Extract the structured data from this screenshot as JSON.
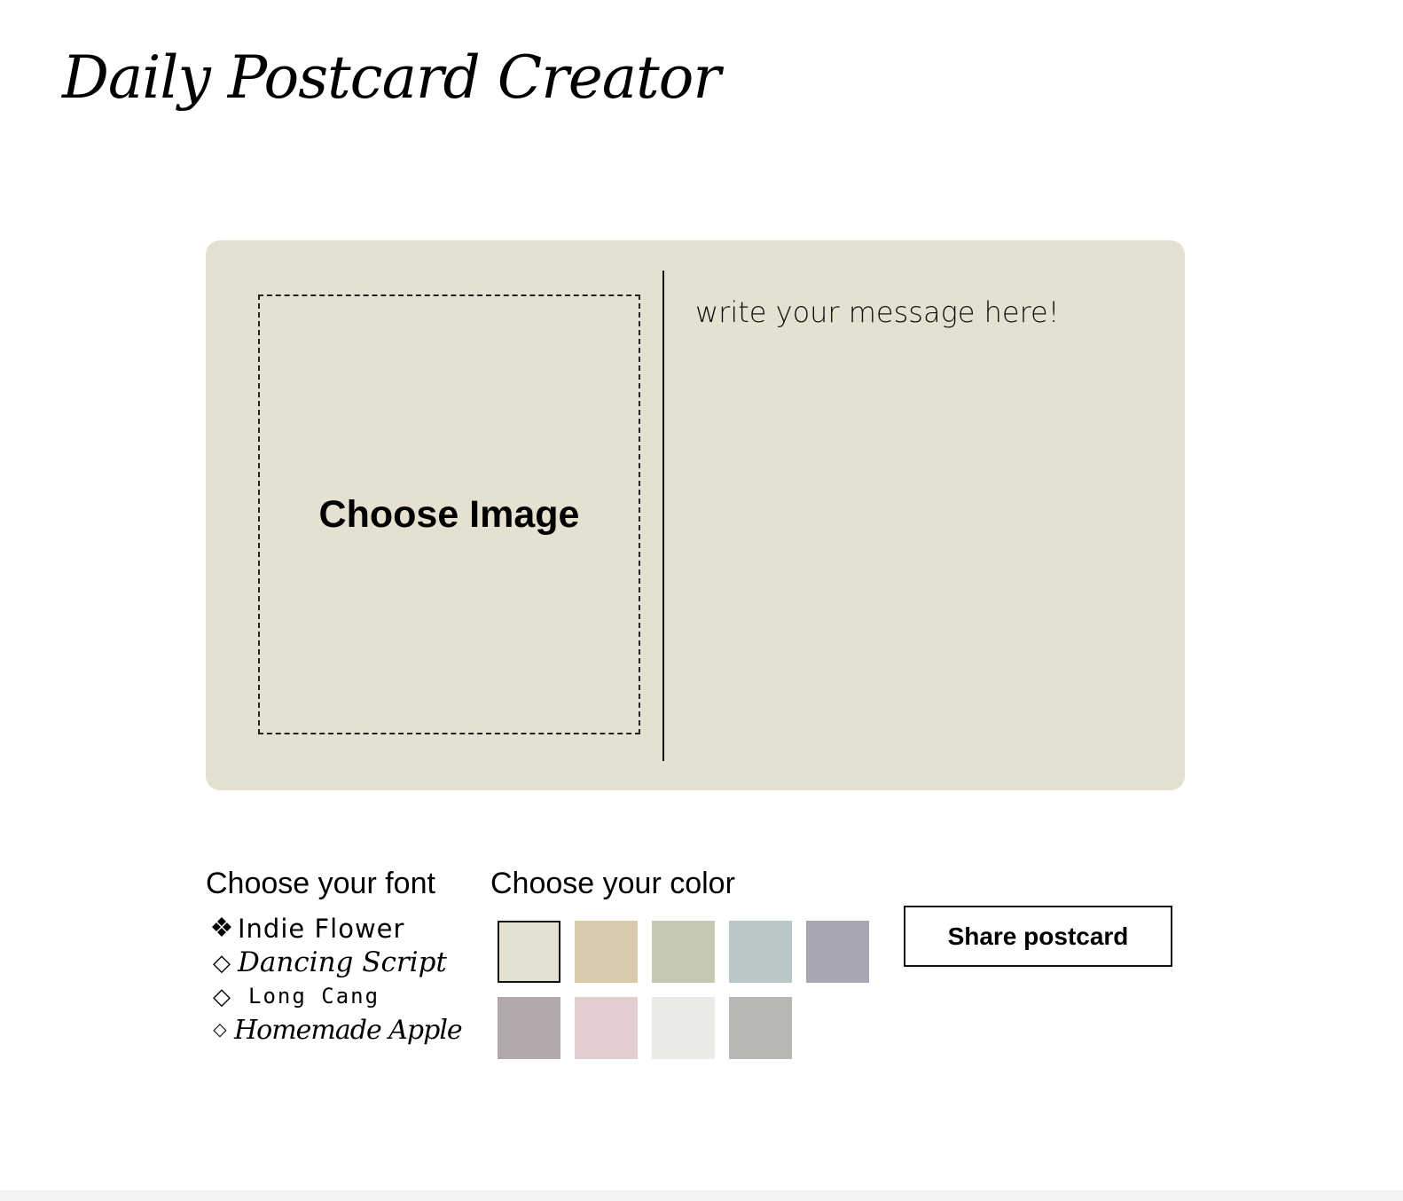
{
  "page": {
    "title": "Daily Postcard Creator"
  },
  "postcard": {
    "background_color": "#e4e1d0",
    "image_picker_label": "Choose Image",
    "message_placeholder": "write your message here!"
  },
  "font_picker": {
    "heading": "Choose your font",
    "options": [
      {
        "label": "Indie Flower",
        "bullet": "❖",
        "selected": true
      },
      {
        "label": "Dancing Script",
        "bullet": "◇",
        "selected": false
      },
      {
        "label": "Long Cang",
        "bullet": "◇",
        "selected": false
      },
      {
        "label": "Homemade Apple",
        "bullet": "◇",
        "selected": false
      }
    ]
  },
  "color_picker": {
    "heading": "Choose your color",
    "swatches": [
      {
        "color": "#e4e1d0",
        "selected": true
      },
      {
        "color": "#d8cbab",
        "selected": false
      },
      {
        "color": "#c7c8b3",
        "selected": false
      },
      {
        "color": "#b9c7c8",
        "selected": false
      },
      {
        "color": "#a6a6b4",
        "selected": false
      },
      {
        "color": "#b2a7ac",
        "selected": false
      },
      {
        "color": "#e4cfd0",
        "selected": false
      },
      {
        "color": "#eaebe7",
        "selected": false
      },
      {
        "color": "#b9b7b3",
        "selected": false
      }
    ]
  },
  "actions": {
    "share_label": "Share postcard"
  }
}
